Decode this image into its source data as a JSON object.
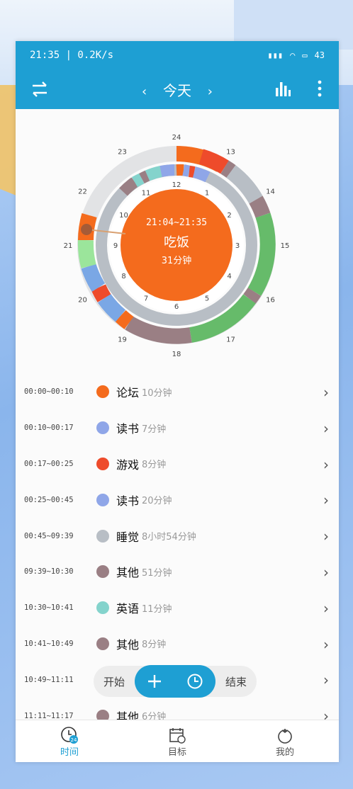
{
  "status_bar": {
    "time_speed": "21:35 | 0.2K/s",
    "battery": "43"
  },
  "toolbar": {
    "title": "今天",
    "prev": "‹",
    "next": "›"
  },
  "clock": {
    "center_time": "21:04~21:35",
    "center_activity": "吃饭",
    "center_duration": "31分钟",
    "inner_labels": [
      "12",
      "1",
      "2",
      "3",
      "4",
      "5",
      "6",
      "7",
      "8",
      "9",
      "10",
      "11"
    ],
    "outer_labels": [
      "24",
      "13",
      "14",
      "15",
      "16",
      "17",
      "18",
      "19",
      "20",
      "21",
      "22",
      "23"
    ],
    "current_color": "#f46b1d"
  },
  "colors": {
    "forum": "#f46b1d",
    "reading": "#8fa6e8",
    "game": "#ee4b2b",
    "sleep": "#b8bec5",
    "other": "#9a7f84",
    "english": "#84d3cc",
    "green": "#66bb6a",
    "light_green": "#9be59b",
    "blue": "#7aa7e5",
    "accent": "#1e9fd3"
  },
  "entries": [
    {
      "time": "00:00~00:10",
      "name": "论坛",
      "duration": "10分钟",
      "color": "#f46b1d"
    },
    {
      "time": "00:10~00:17",
      "name": "读书",
      "duration": "7分钟",
      "color": "#8fa6e8"
    },
    {
      "time": "00:17~00:25",
      "name": "游戏",
      "duration": "8分钟",
      "color": "#ee4b2b"
    },
    {
      "time": "00:25~00:45",
      "name": "读书",
      "duration": "20分钟",
      "color": "#8fa6e8"
    },
    {
      "time": "00:45~09:39",
      "name": "睡觉",
      "duration": "8小时54分钟",
      "color": "#b8bec5"
    },
    {
      "time": "09:39~10:30",
      "name": "其他",
      "duration": "51分钟",
      "color": "#9a7f84"
    },
    {
      "time": "10:30~10:41",
      "name": "英语",
      "duration": "11分钟",
      "color": "#84d3cc"
    },
    {
      "time": "10:41~10:49",
      "name": "其他",
      "duration": "8分钟",
      "color": "#9a7f84"
    },
    {
      "time": "10:49~11:11",
      "name": "",
      "duration": "",
      "color": "#84d3cc"
    },
    {
      "time": "11:11~11:17",
      "name": "其他",
      "duration": "6分钟",
      "color": "#9a7f84"
    }
  ],
  "fab": {
    "start": "开始",
    "end": "结束"
  },
  "tabs": [
    {
      "label": "时间",
      "icon": "clock-24-icon",
      "active": true
    },
    {
      "label": "目标",
      "icon": "calendar-goal-icon",
      "active": false
    },
    {
      "label": "我的",
      "icon": "tomato-icon",
      "active": false
    }
  ],
  "tab_badge": "24"
}
